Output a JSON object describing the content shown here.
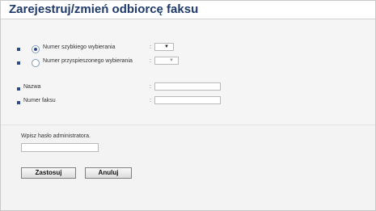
{
  "header": {
    "title": "Zarejestruj/zmień odbiorcę faksu"
  },
  "form": {
    "speed_dial": {
      "label": "Numer szybkiego wybierania",
      "selected": true,
      "value": ""
    },
    "quick_dial": {
      "label": "Numer przyspieszonego wybierania",
      "selected": false,
      "value": ""
    },
    "name": {
      "label": "Nazwa",
      "value": ""
    },
    "fax_number": {
      "label": "Numer faksu",
      "value": ""
    },
    "colon": ":"
  },
  "admin": {
    "password_label": "Wpisz hasło administratora.",
    "password_value": ""
  },
  "buttons": {
    "apply": "Zastosuj",
    "cancel": "Anuluj"
  },
  "icons": {
    "dropdown": "chevron-down-icon",
    "bullet": "square-bullet-icon"
  },
  "colors": {
    "title": "#1f3a6b",
    "bullet": "#2b4a8a",
    "background": "#f5f5f5"
  }
}
